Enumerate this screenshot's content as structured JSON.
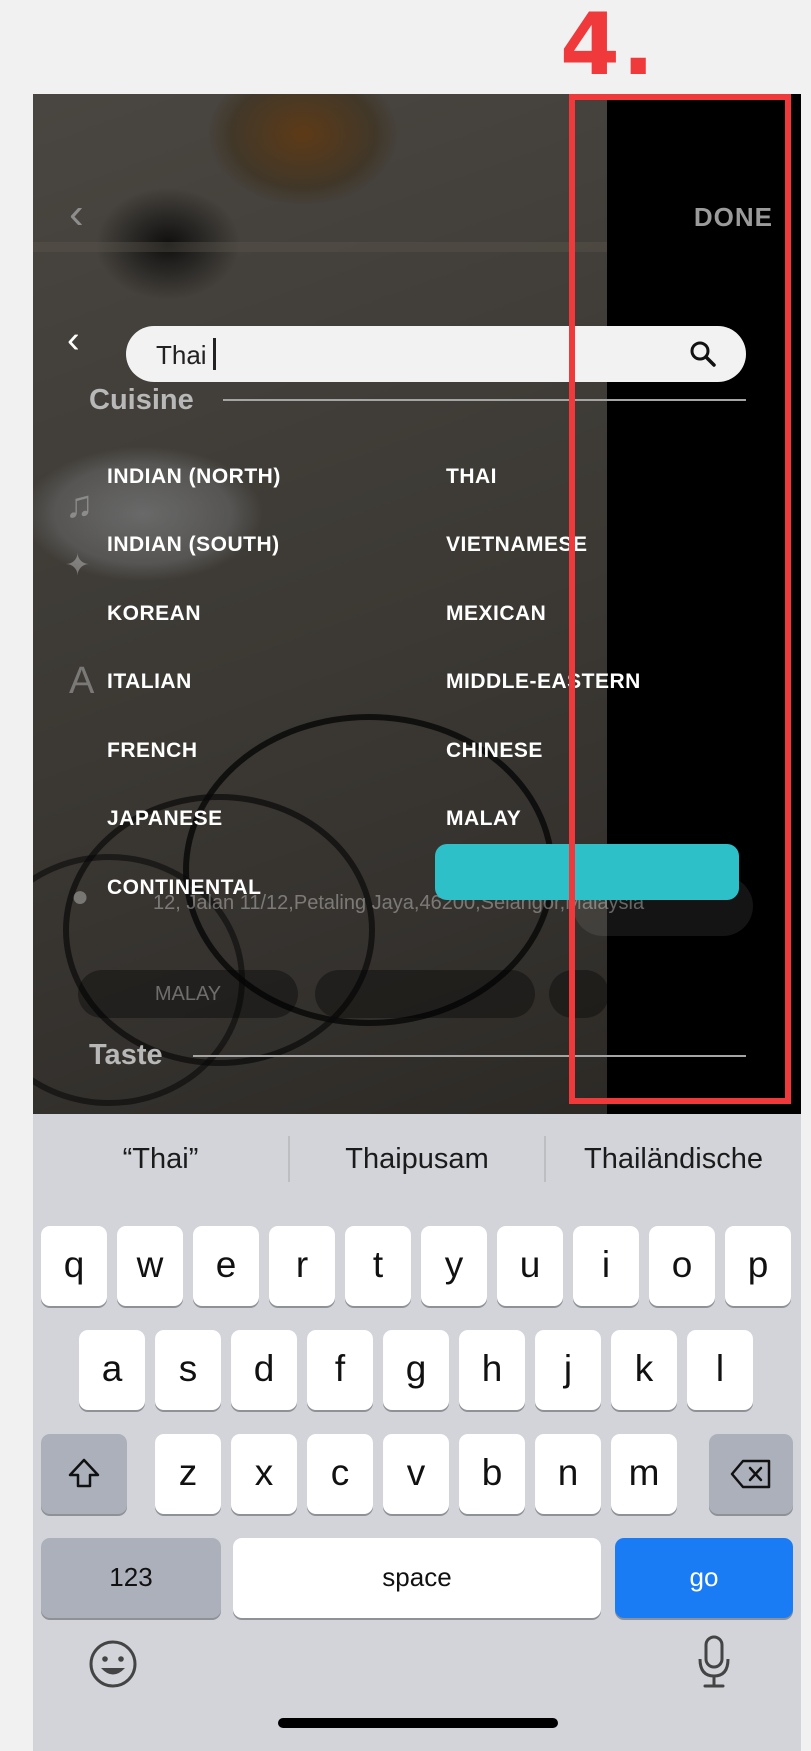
{
  "step_label": "4.",
  "header": {
    "done_label": "DONE"
  },
  "search": {
    "value": "Thai",
    "placeholder": ""
  },
  "sections": {
    "cuisine_title": "Cuisine",
    "taste_title": "Taste"
  },
  "cuisines": {
    "left": [
      "INDIAN (NORTH)",
      "INDIAN (SOUTH)",
      "KOREAN",
      "ITALIAN",
      "FRENCH",
      "JAPANESE",
      "CONTINENTAL"
    ],
    "right": [
      "THAI",
      "VIETNAMESE",
      "MEXICAN",
      "MIDDLE-EASTERN",
      "CHINESE",
      "MALAY"
    ],
    "selected": "MALAY"
  },
  "background": {
    "address": "12, Jalan 11/12,Petaling Jaya,46200,Selangor,Malaysia",
    "tag": "MALAY"
  },
  "keyboard": {
    "suggestions": [
      "“Thai”",
      "Thaipusam",
      "Thailändische"
    ],
    "row1": [
      "q",
      "w",
      "e",
      "r",
      "t",
      "y",
      "u",
      "i",
      "o",
      "p"
    ],
    "row2": [
      "a",
      "s",
      "d",
      "f",
      "g",
      "h",
      "j",
      "k",
      "l"
    ],
    "row3": [
      "z",
      "x",
      "c",
      "v",
      "b",
      "n",
      "m"
    ],
    "numbers_label": "123",
    "space_label": "space",
    "go_label": "go"
  },
  "colors": {
    "accent": "#2dc0c8",
    "annotation": "#f0393b",
    "go_key": "#1a7cf5"
  }
}
